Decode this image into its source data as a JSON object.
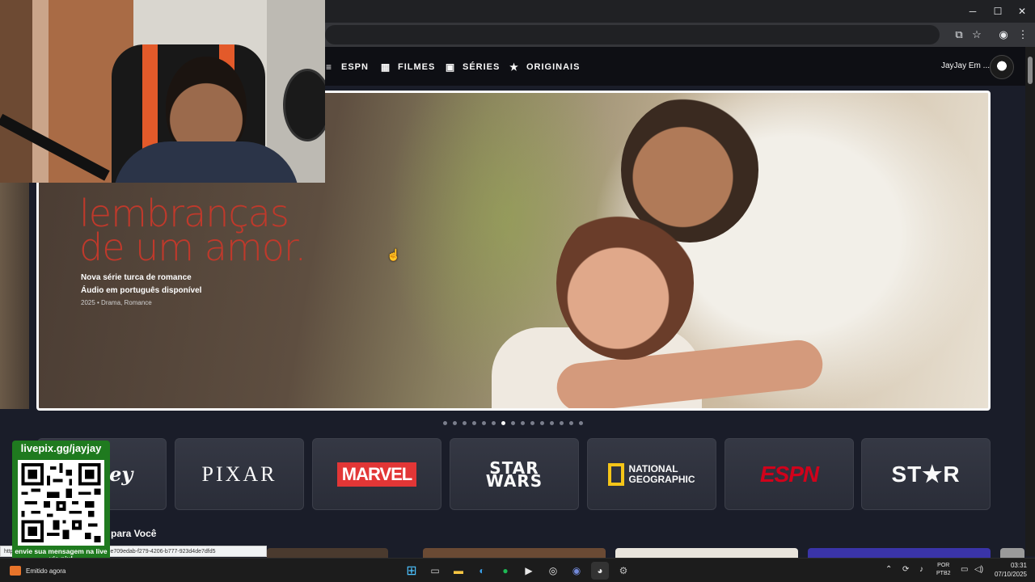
{
  "window": {
    "controls": [
      "─",
      "☐",
      "✕"
    ]
  },
  "nav": {
    "items": [
      {
        "label": "ESPN",
        "icon": "list-icon"
      },
      {
        "label": "FILMES",
        "icon": "film-icon"
      },
      {
        "label": "SÉRIES",
        "icon": "tv-icon"
      },
      {
        "label": "ORIGINAIS",
        "icon": "star-icon"
      }
    ],
    "profile_name": "JayJay Em ..."
  },
  "hero": {
    "title_line1": "lembranças",
    "title_line2": "de um amor.",
    "subtitle_line1": "Nova série turca de romance",
    "subtitle_line2": "Áudio em português disponível",
    "meta": "2025 • Drama, Romance",
    "carousel_count": 15,
    "carousel_active_index": 6
  },
  "brands": [
    {
      "name": "Disney",
      "label": "ney"
    },
    {
      "name": "Pixar",
      "label": "PIXAR"
    },
    {
      "name": "Marvel",
      "label": "MARVEL"
    },
    {
      "name": "Star Wars",
      "label_line1": "STAR",
      "label_line2": "WARS"
    },
    {
      "name": "National Geographic",
      "label_line1": "NATIONAL",
      "label_line2": "GEOGRAPHIC"
    },
    {
      "name": "ESPN",
      "label": "ESPN"
    },
    {
      "name": "Star",
      "label": "ST★R"
    }
  ],
  "row": {
    "title": "para Você"
  },
  "status_url": "https://www.disneyplus.com/browse/entity-e709edab-f279-4206-b777-923d4de7dfd5",
  "overlay": {
    "top": "livepix.gg/jayjay",
    "bottom": "envie sua mensagem na live via pix!"
  },
  "taskbar": {
    "notification": "Emitido agora",
    "lang_line1": "POR",
    "lang_line2": "PTB2",
    "time": "03:31",
    "date": "07/10/2025"
  },
  "colors": {
    "nav_bg": "#0e0f14",
    "page_bg": "#1a1d29",
    "hero_title": "#c0392b",
    "livepix_green": "#1f7a1f"
  }
}
